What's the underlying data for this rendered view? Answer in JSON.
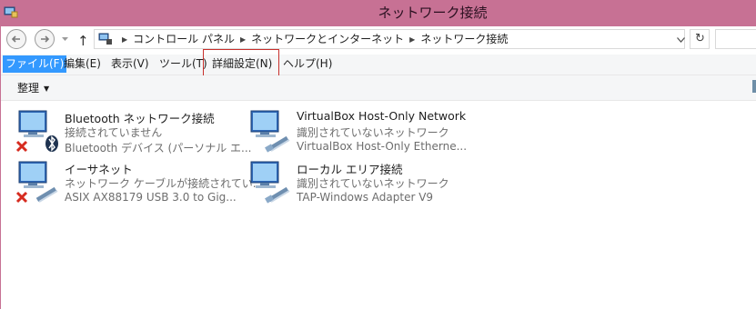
{
  "window": {
    "title": "ネットワーク接続"
  },
  "address_bar": {
    "breadcrumbs": [
      "コントロール パネル",
      "ネットワークとインターネット",
      "ネットワーク接続"
    ]
  },
  "menu": {
    "items": [
      {
        "label": "ファイル(F)",
        "active": true
      },
      {
        "label": "編集(E)"
      },
      {
        "label": "表示(V)"
      },
      {
        "label": "ツール(T)"
      },
      {
        "label": "詳細設定(N)",
        "highlighted": true
      },
      {
        "label": "ヘルプ(H)"
      }
    ]
  },
  "command_bar": {
    "organize_label": "整理"
  },
  "connections": [
    {
      "name": "Bluetooth ネットワーク接続",
      "status": "接続されていません",
      "device": "Bluetooth デバイス (パーソナル エ...",
      "icon": "bluetooth-network-icon",
      "disabled": true
    },
    {
      "name": "VirtualBox Host-Only Network",
      "status": "識別されていないネットワーク",
      "device": "VirtualBox Host-Only Etherne...",
      "icon": "ethernet-network-icon",
      "disabled": false
    },
    {
      "name": "イーサネット",
      "status": "ネットワーク ケーブルが接続されてい...",
      "device": "ASIX AX88179 USB 3.0 to Gig...",
      "icon": "ethernet-network-icon",
      "disabled": true
    },
    {
      "name": "ローカル エリア接続",
      "status": "識別されていないネットワーク",
      "device": "TAP-Windows Adapter V9",
      "icon": "ethernet-network-icon",
      "disabled": false
    }
  ],
  "colors": {
    "titlebar": "#c77194",
    "menu_active": "#3399ff",
    "highlight_box": "#c8302c"
  }
}
